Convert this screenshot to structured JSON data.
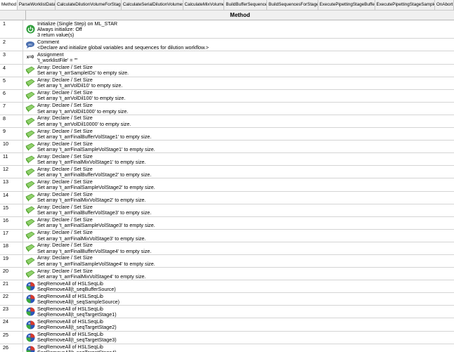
{
  "tabs": [
    "Method",
    "ParseWorklistData",
    "CalculateDilutionVolumeForStage",
    "CalculateSerialDilutionVolumes",
    "CalculateMixVolume",
    "BuildBufferSequence",
    "BuildSequencesForStage",
    "ExecutePipettingStageBuffer",
    "ExecutePipettingStageSample",
    "OnAbort"
  ],
  "header": {
    "column": "Method"
  },
  "rows": [
    {
      "n": "1",
      "icon": "power-icon",
      "lines": [
        "Initialize (Single Step) on ML_STAR",
        "Always initialize: Off",
        "3 return value(s)"
      ]
    },
    {
      "n": "2",
      "icon": "comment-icon",
      "lines": [
        "Comment",
        "<Declare and initialize global variables and sequences for dilution workflow.>"
      ]
    },
    {
      "n": "3",
      "icon": "assignment-icon",
      "icon_text": "x=0",
      "lines": [
        "Assignment",
        "'t_worklistFile' = \"\""
      ]
    },
    {
      "n": "4",
      "icon": "array-icon",
      "lines": [
        "Array: Declare / Set Size",
        "Set array 't_arrSampleIDs' to empty size."
      ]
    },
    {
      "n": "5",
      "icon": "array-icon",
      "lines": [
        "Array: Declare / Set Size",
        "Set array 't_arrVolDil10' to empty size."
      ]
    },
    {
      "n": "6",
      "icon": "array-icon",
      "lines": [
        "Array: Declare / Set Size",
        "Set array 't_arrVolDil100' to empty size."
      ]
    },
    {
      "n": "7",
      "icon": "array-icon",
      "lines": [
        "Array: Declare / Set Size",
        "Set array 't_arrVolDil1000' to empty size."
      ]
    },
    {
      "n": "8",
      "icon": "array-icon",
      "lines": [
        "Array: Declare / Set Size",
        "Set array 't_arrVolDil10000' to empty size."
      ]
    },
    {
      "n": "9",
      "icon": "array-icon",
      "lines": [
        "Array: Declare / Set Size",
        "Set array 't_arrFinalBufferVolStage1' to empty size."
      ]
    },
    {
      "n": "10",
      "icon": "array-icon",
      "lines": [
        "Array: Declare / Set Size",
        "Set array 't_arrFinalSampleVolStage1' to empty size."
      ]
    },
    {
      "n": "11",
      "icon": "array-icon",
      "lines": [
        "Array: Declare / Set Size",
        "Set array 't_arrFinalMixVolStage1' to empty size."
      ]
    },
    {
      "n": "12",
      "icon": "array-icon",
      "lines": [
        "Array: Declare / Set Size",
        "Set array 't_arrFinalBufferVolStage2' to empty size."
      ]
    },
    {
      "n": "13",
      "icon": "array-icon",
      "lines": [
        "Array: Declare / Set Size",
        "Set array 't_arrFinalSampleVolStage2' to empty size."
      ]
    },
    {
      "n": "14",
      "icon": "array-icon",
      "lines": [
        "Array: Declare / Set Size",
        "Set array 't_arrFinalMixVolStage2' to empty size."
      ]
    },
    {
      "n": "15",
      "icon": "array-icon",
      "lines": [
        "Array: Declare / Set Size",
        "Set array 't_arrFinalBufferVolStage3' to empty size."
      ]
    },
    {
      "n": "16",
      "icon": "array-icon",
      "lines": [
        "Array: Declare / Set Size",
        "Set array 't_arrFinalSampleVolStage3' to empty size."
      ]
    },
    {
      "n": "17",
      "icon": "array-icon",
      "lines": [
        "Array: Declare / Set Size",
        "Set array 't_arrFinalMixVolStage3' to empty size."
      ]
    },
    {
      "n": "18",
      "icon": "array-icon",
      "lines": [
        "Array: Declare / Set Size",
        "Set array 't_arrFinalBufferVolStage4' to empty size."
      ]
    },
    {
      "n": "19",
      "icon": "array-icon",
      "lines": [
        "Array: Declare / Set Size",
        "Set array 't_arrFinalSampleVolStage4' to empty size."
      ]
    },
    {
      "n": "20",
      "icon": "array-icon",
      "lines": [
        "Array: Declare / Set Size",
        "Set array 't_arrFinalMixVolStage4' to empty size."
      ]
    },
    {
      "n": "21",
      "icon": "library-icon",
      "lines": [
        "SeqRemoveAll of HSLSeqLib",
        "SeqRemoveAll(t_seqBufferSource)"
      ]
    },
    {
      "n": "22",
      "icon": "library-icon",
      "lines": [
        "SeqRemoveAll of HSLSeqLib",
        "SeqRemoveAll(t_seqSampleSource)"
      ]
    },
    {
      "n": "23",
      "icon": "library-icon",
      "lines": [
        "SeqRemoveAll of HSLSeqLib",
        "SeqRemoveAll(t_seqTargetStage1)"
      ]
    },
    {
      "n": "24",
      "icon": "library-icon",
      "lines": [
        "SeqRemoveAll of HSLSeqLib",
        "SeqRemoveAll(t_seqTargetStage2)"
      ]
    },
    {
      "n": "25",
      "icon": "library-icon",
      "lines": [
        "SeqRemoveAll of HSLSeqLib",
        "SeqRemoveAll(t_seqTargetStage3)"
      ]
    },
    {
      "n": "26",
      "icon": "library-icon",
      "lines": [
        "SeqRemoveAll of HSLSeqLib",
        "SeqRemoveAll(t_seqTargetStage4)"
      ]
    }
  ]
}
